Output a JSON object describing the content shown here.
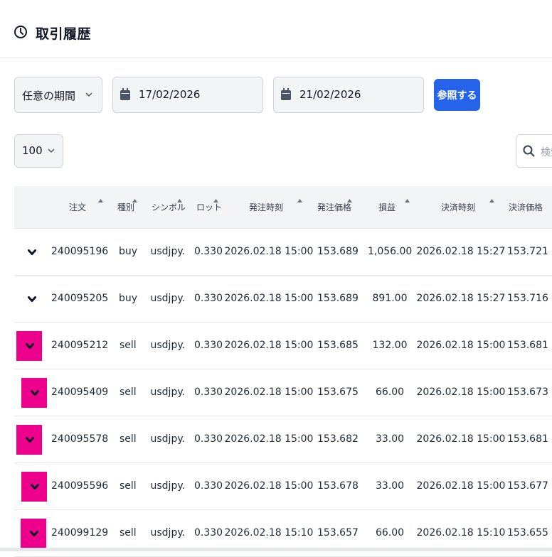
{
  "header": {
    "title": "取引履歴",
    "icon": "clock-icon"
  },
  "filters": {
    "period": "任意の期間",
    "date_from": "17/02/2026",
    "date_to": "21/02/2026",
    "search_button": "参照する",
    "page_size": "100",
    "search_placeholder": "検索"
  },
  "colors": {
    "accent": "#2563eb",
    "highlight": "#ec008c"
  },
  "table": {
    "columns": [
      "注文",
      "種別",
      "シンボル",
      "ロット",
      "発注時刻",
      "発注価格",
      "損益",
      "決済時刻",
      "決済価格"
    ],
    "rows": [
      {
        "order": "240095196",
        "type": "buy",
        "symbol": "usdjpy.",
        "lot": "0.330",
        "open_time": "2026.02.18 15:00",
        "open_price": "153.689",
        "profit": "1,056.00",
        "close_time": "2026.02.18 15:27",
        "close_price": "153.721",
        "highlighted": false
      },
      {
        "order": "240095205",
        "type": "buy",
        "symbol": "usdjpy.",
        "lot": "0.330",
        "open_time": "2026.02.18 15:00",
        "open_price": "153.689",
        "profit": "891.00",
        "close_time": "2026.02.18 15:27",
        "close_price": "153.716",
        "highlighted": false
      },
      {
        "order": "240095212",
        "type": "sell",
        "symbol": "usdjpy.",
        "lot": "0.330",
        "open_time": "2026.02.18 15:00",
        "open_price": "153.685",
        "profit": "132.00",
        "close_time": "2026.02.18 15:00",
        "close_price": "153.681",
        "highlighted": true
      },
      {
        "order": "240095409",
        "type": "sell",
        "symbol": "usdjpy.",
        "lot": "0.330",
        "open_time": "2026.02.18 15:00",
        "open_price": "153.675",
        "profit": "66.00",
        "close_time": "2026.02.18 15:00",
        "close_price": "153.673",
        "highlighted": true
      },
      {
        "order": "240095578",
        "type": "sell",
        "symbol": "usdjpy.",
        "lot": "0.330",
        "open_time": "2026.02.18 15:00",
        "open_price": "153.682",
        "profit": "33.00",
        "close_time": "2026.02.18 15:00",
        "close_price": "153.681",
        "highlighted": true
      },
      {
        "order": "240095596",
        "type": "sell",
        "symbol": "usdjpy.",
        "lot": "0.330",
        "open_time": "2026.02.18 15:00",
        "open_price": "153.678",
        "profit": "33.00",
        "close_time": "2026.02.18 15:00",
        "close_price": "153.677",
        "highlighted": true
      },
      {
        "order": "240099129",
        "type": "sell",
        "symbol": "usdjpy.",
        "lot": "0.330",
        "open_time": "2026.02.18 15:10",
        "open_price": "153.657",
        "profit": "66.00",
        "close_time": "2026.02.18 15:10",
        "close_price": "153.655",
        "highlighted": true
      }
    ]
  }
}
